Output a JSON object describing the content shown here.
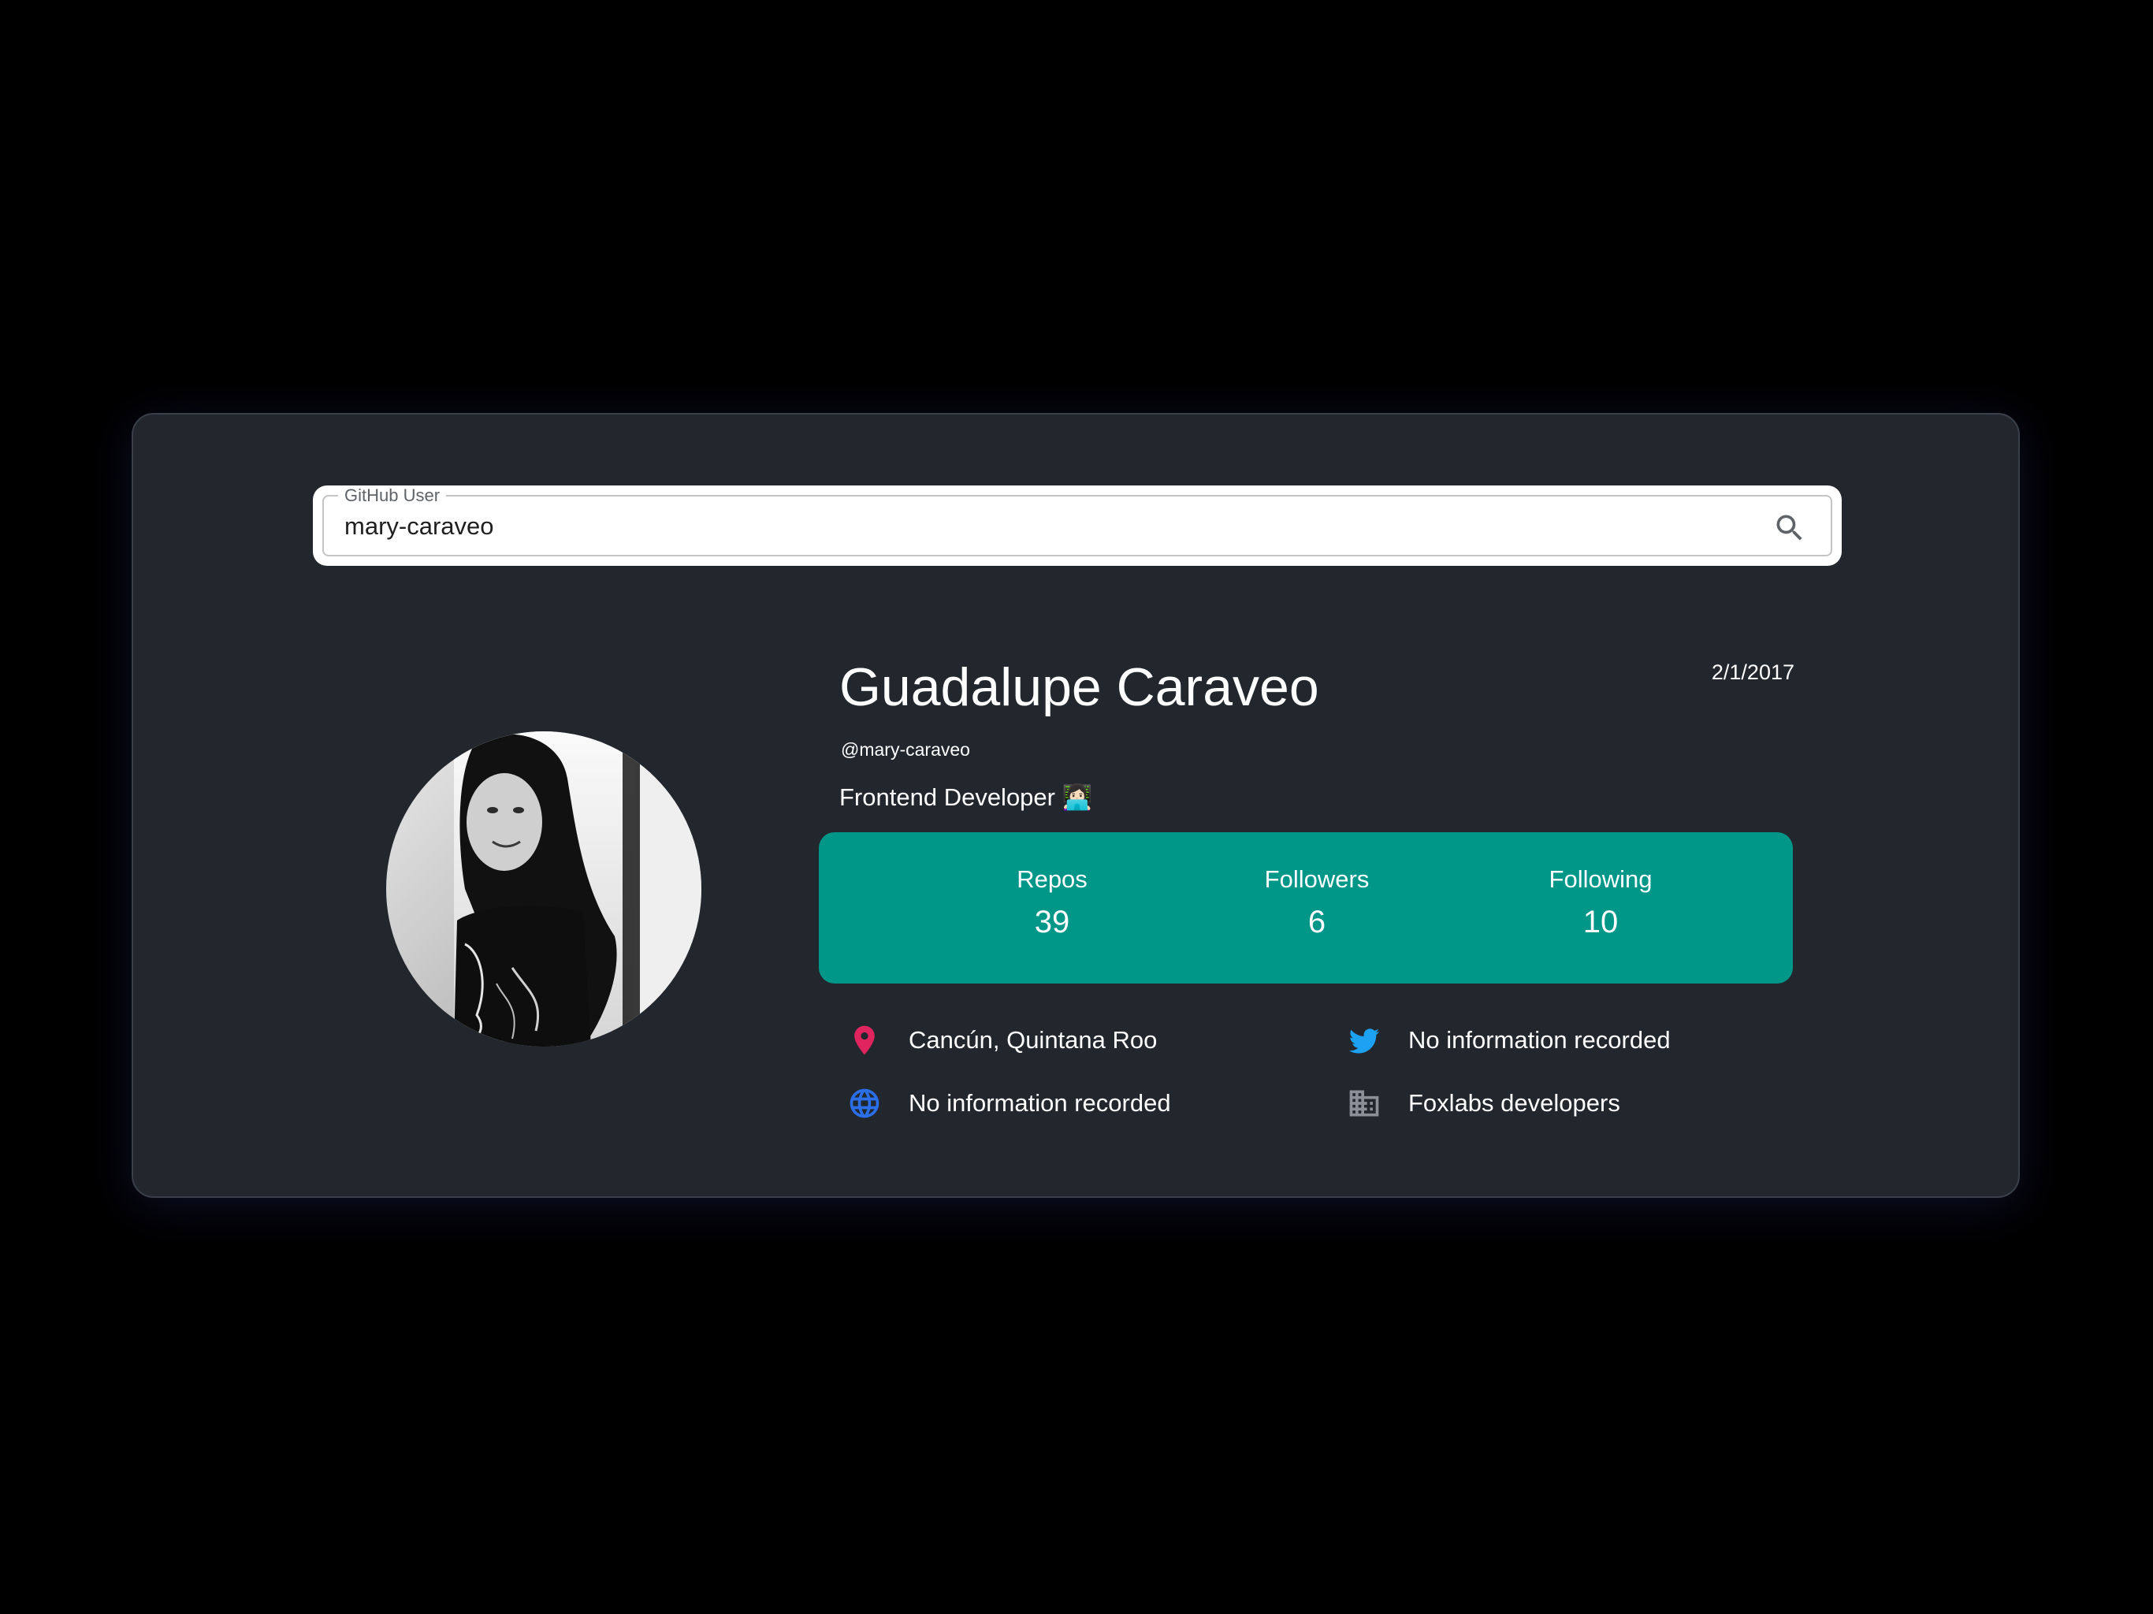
{
  "search": {
    "label": "GitHub User",
    "value": "mary-caraveo"
  },
  "profile": {
    "name": "Guadalupe Caraveo",
    "joined": "2/1/2017",
    "handle": "@mary-caraveo",
    "bio": "Frontend Developer 👩🏻‍💻"
  },
  "stats": [
    {
      "label": "Repos",
      "value": "39"
    },
    {
      "label": "Followers",
      "value": "6"
    },
    {
      "label": "Following",
      "value": "10"
    }
  ],
  "info": {
    "location": {
      "text": "Cancún, Quintana Roo",
      "icon": "location-pin-icon",
      "color": "#e0245e"
    },
    "twitter": {
      "text": "No information recorded",
      "icon": "twitter-icon",
      "color": "#1da1f2"
    },
    "website": {
      "text": "No information recorded",
      "icon": "globe-icon",
      "color": "#2a6ee8"
    },
    "company": {
      "text": "Foxlabs developers",
      "icon": "building-icon",
      "color": "#8a8f98"
    }
  },
  "colors": {
    "background": "#000000",
    "card": "#22272e",
    "stats_panel": "#009688"
  }
}
